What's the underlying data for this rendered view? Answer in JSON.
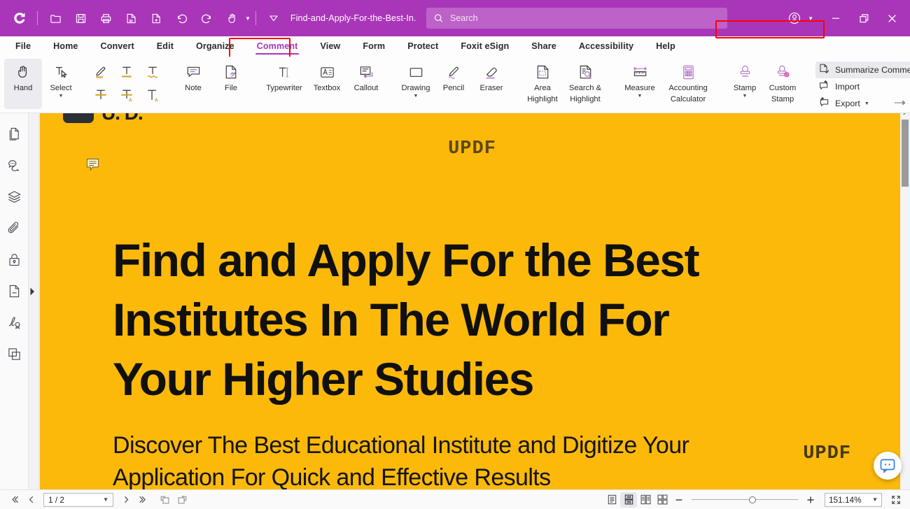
{
  "titlebar": {
    "logo_icon": "updf-logo-icon",
    "quick_tools": [
      {
        "name": "open-file-icon",
        "title": "Open"
      },
      {
        "name": "save-icon",
        "title": "Save"
      },
      {
        "name": "print-icon",
        "title": "Print"
      },
      {
        "name": "save-as-icon",
        "title": "Save As"
      },
      {
        "name": "new-file-icon",
        "title": "New"
      },
      {
        "name": "undo-icon",
        "title": "Undo"
      },
      {
        "name": "redo-icon",
        "title": "Redo"
      },
      {
        "name": "hand-tool-icon",
        "title": "Hand"
      }
    ],
    "tab_dropdown_icon": "chevron-down-icon",
    "document_title": "Find-and-Apply-For-the-Best-In...",
    "search": {
      "icon": "search-icon",
      "placeholder": "Search",
      "value": ""
    },
    "account_icon": "account-icon",
    "window": {
      "minimize": "minimize-icon",
      "restore": "restore-icon",
      "close": "close-icon"
    }
  },
  "menu": {
    "items": [
      {
        "label": "File",
        "active": false
      },
      {
        "label": "Home",
        "active": false
      },
      {
        "label": "Convert",
        "active": false
      },
      {
        "label": "Edit",
        "active": false
      },
      {
        "label": "Organize",
        "active": false
      },
      {
        "label": "Comment",
        "active": true
      },
      {
        "label": "View",
        "active": false
      },
      {
        "label": "Form",
        "active": false
      },
      {
        "label": "Protect",
        "active": false
      },
      {
        "label": "Foxit eSign",
        "active": false
      },
      {
        "label": "Share",
        "active": false
      },
      {
        "label": "Accessibility",
        "active": false
      },
      {
        "label": "Help",
        "active": false
      }
    ],
    "highlight_color": "#ff0000",
    "accent_color": "#a936b9"
  },
  "ribbon": {
    "tools": [
      {
        "label": "Hand",
        "icon": "hand-icon",
        "selected": true,
        "caret": false
      },
      {
        "label": "Select",
        "icon": "select-text-icon",
        "selected": false,
        "caret": true
      }
    ],
    "markup_icons": [
      {
        "name": "highlight-icon"
      },
      {
        "name": "underline-icon"
      },
      {
        "name": "squiggly-underline-icon"
      },
      {
        "name": "strikethrough-icon"
      },
      {
        "name": "replace-text-icon"
      },
      {
        "name": "insert-text-icon"
      }
    ],
    "attach": [
      {
        "label": "Note",
        "icon": "note-icon"
      },
      {
        "label": "File",
        "icon": "attach-file-icon"
      }
    ],
    "text_tools": [
      {
        "label": "Typewriter",
        "icon": "typewriter-icon"
      },
      {
        "label": "Textbox",
        "icon": "textbox-icon"
      },
      {
        "label": "Callout",
        "icon": "callout-icon"
      }
    ],
    "draw_tools": [
      {
        "label": "Drawing",
        "icon": "drawing-icon",
        "caret": true
      },
      {
        "label": "Pencil",
        "icon": "pencil-icon",
        "caret": false
      },
      {
        "label": "Eraser",
        "icon": "eraser-icon",
        "caret": false
      }
    ],
    "highlight_tools": [
      {
        "label": "Area",
        "label2": "Highlight",
        "icon": "area-highlight-icon"
      },
      {
        "label": "Search &",
        "label2": "Highlight",
        "icon": "search-highlight-icon"
      }
    ],
    "measure_tools": [
      {
        "label": "Measure",
        "label2": "",
        "icon": "measure-icon",
        "caret": true
      },
      {
        "label": "Accounting",
        "label2": "Calculator",
        "icon": "calculator-icon",
        "caret": false
      }
    ],
    "stamp_tools": [
      {
        "label": "Stamp",
        "label2": "",
        "icon": "stamp-icon",
        "caret": true
      },
      {
        "label": "Custom",
        "label2": "Stamp",
        "icon": "custom-stamp-icon",
        "caret": true
      }
    ],
    "comment_actions": [
      {
        "label": "Summarize Comments",
        "icon": "summarize-comments-icon",
        "highlighted": true
      },
      {
        "label": "Import",
        "icon": "import-comments-icon",
        "highlighted": false
      },
      {
        "label": "Export",
        "icon": "export-comments-icon",
        "highlighted": false,
        "caret": true
      }
    ],
    "tail_icons": [
      {
        "name": "show-comments-icon",
        "caret": false
      },
      {
        "name": "comment-settings-icon",
        "caret": true
      },
      {
        "name": "pin-comment-icon",
        "caret": false
      }
    ],
    "collapse_icon": "collapse-ribbon-icon"
  },
  "sidebar": {
    "items": [
      {
        "name": "sidebar-item-thumbnails",
        "icon": "page-thumbnails-icon"
      },
      {
        "name": "sidebar-item-comments",
        "icon": "comments-icon"
      },
      {
        "name": "sidebar-item-layers",
        "icon": "layers-icon"
      },
      {
        "name": "sidebar-item-attachments",
        "icon": "paperclip-icon"
      },
      {
        "name": "sidebar-item-security",
        "icon": "lock-icon"
      },
      {
        "name": "sidebar-item-form-fields",
        "icon": "form-field-icon"
      },
      {
        "name": "sidebar-item-signatures",
        "icon": "signature-icon"
      },
      {
        "name": "sidebar-item-compare",
        "icon": "compare-icon"
      }
    ],
    "expand_handle_icon": "expand-pane-icon"
  },
  "document": {
    "page_color": "#fcb90a",
    "logo_text": "U. D.",
    "note_marker_icon": "sticky-note-marker-icon",
    "watermark_top": "UPDF",
    "watermark_bottom": "UPDF",
    "headline": "Find and Apply For the Best Institutes In The World For Your Higher Studies",
    "subline": "Discover The Best Educational Institute and Digitize Your Application For Quick and Effective Results",
    "support_bubble_icon": "support-chat-icon"
  },
  "statusbar": {
    "first_page_icon": "first-page-icon",
    "prev_page_icon": "prev-page-icon",
    "page_value": "1 / 2",
    "page_dropdown_icon": "chevron-down-icon",
    "next_page_icon": "next-page-icon",
    "last_page_icon": "last-page-icon",
    "rotate_left_icon": "rotate-left-icon",
    "rotate_right_icon": "rotate-right-icon",
    "view_modes": [
      {
        "name": "single-page-view",
        "icon": "single-page-icon",
        "active": false
      },
      {
        "name": "continuous-scroll-view",
        "icon": "continuous-scroll-icon",
        "active": true
      },
      {
        "name": "two-page-view",
        "icon": "two-page-icon",
        "active": false
      },
      {
        "name": "two-page-scroll-view",
        "icon": "two-page-scroll-icon",
        "active": false
      }
    ],
    "zoom_out_icon": "zoom-out-icon",
    "zoom_in_icon": "zoom-in-icon",
    "zoom_value": "151.14%",
    "zoom_dropdown_icon": "chevron-down-icon",
    "fullscreen_icon": "fullscreen-icon"
  }
}
